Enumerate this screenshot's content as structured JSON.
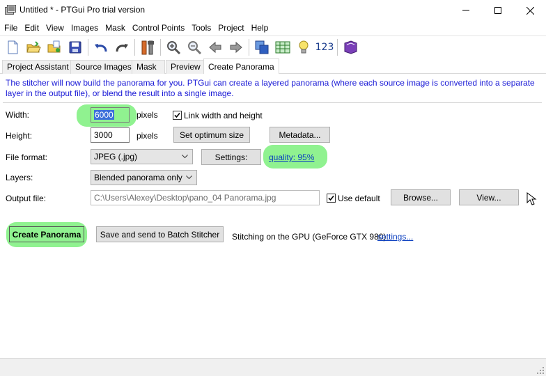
{
  "window": {
    "title": "Untitled * - PTGui Pro trial version"
  },
  "menu": [
    "File",
    "Edit",
    "View",
    "Images",
    "Mask",
    "Control Points",
    "Tools",
    "Project",
    "Help"
  ],
  "toolbar": {
    "icons": [
      "new-file-icon",
      "open-folder-icon",
      "open-recent-icon",
      "save-icon",
      "undo-icon",
      "redo-icon",
      "tools-icon",
      "zoom-in-icon",
      "zoom-out-icon",
      "back-arrow-icon",
      "forward-arrow-icon",
      "panorama-editor-icon",
      "table-icon",
      "lightbulb-icon",
      "numbers-icon",
      "book-icon"
    ],
    "numbers_label": "123"
  },
  "tabs": {
    "project_assistant": "Project Assistant",
    "source_images": "Source Images",
    "mask": "Mask",
    "preview": "Preview",
    "create_panorama": "Create Panorama"
  },
  "create_panorama": {
    "intro": "The stitcher will now build the panorama for you. PTGui can create a layered panorama (where each source image is converted into a separate layer in the output file), or blend the result into a single image.",
    "width_label": "Width:",
    "width_value": "6000",
    "height_label": "Height:",
    "height_value": "3000",
    "pixels_label": "pixels",
    "link_label": "Link width and height",
    "link_checked": true,
    "optimum_button": "Set optimum size",
    "metadata_button": "Metadata...",
    "file_format_label": "File format:",
    "file_format_value": "JPEG (.jpg)",
    "settings_button": "Settings:",
    "quality_link": "quality: 95%",
    "layers_label": "Layers:",
    "layers_value": "Blended panorama only",
    "output_label": "Output file:",
    "output_value": "C:\\Users\\Alexey\\Desktop\\pano_04 Panorama.jpg",
    "use_default_label": "Use default",
    "use_default_checked": true,
    "browse_button": "Browse...",
    "view_button": "View...",
    "create_button": "Create Panorama",
    "batch_button": "Save and send to Batch Stitcher",
    "gpu_text": "Stitching on the GPU (GeForce GTX 980).",
    "gpu_settings_link": "settings..."
  },
  "colors": {
    "highlight": "#7cf07c",
    "intro_text": "#1a1ad6",
    "link": "#0b3fbf"
  }
}
